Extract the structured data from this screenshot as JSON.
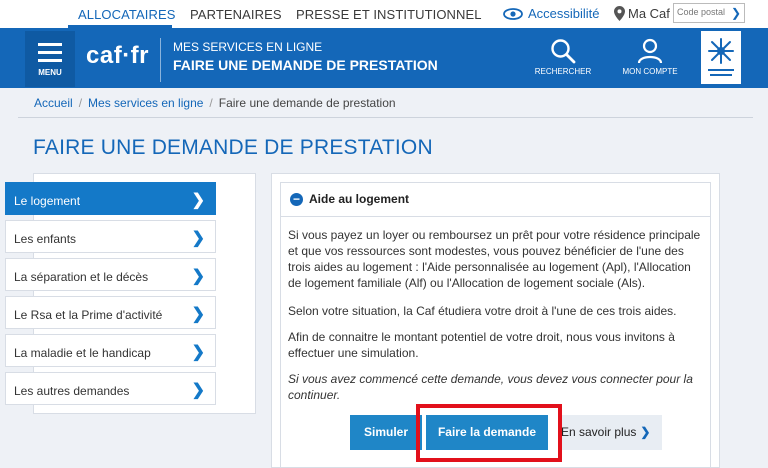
{
  "topnav": {
    "tabs": [
      "ALLOCATAIRES",
      "PARTENAIRES",
      "PRESSE ET INSTITUTIONNEL"
    ],
    "accessibility": "Accessibilité",
    "ma_caf": "Ma Caf",
    "postal_placeholder": "Code postal"
  },
  "header": {
    "menu_label": "MENU",
    "logo": "caf·fr",
    "subtitle": "MES SERVICES EN LIGNE",
    "title": "FAIRE UNE DEMANDE DE PRESTATION",
    "search_label": "RECHERCHER",
    "account_label": "MON COMPTE",
    "brand_color": "#1467b8"
  },
  "breadcrumb": {
    "items": [
      "Accueil",
      "Mes services en ligne",
      "Faire une demande de prestation"
    ],
    "separator": "/"
  },
  "page_title": "FAIRE UNE DEMANDE DE PRESTATION",
  "sidebar": {
    "items": [
      {
        "label": "Le logement"
      },
      {
        "label": "Les enfants"
      },
      {
        "label": "La séparation et le décès"
      },
      {
        "label": "Le Rsa et la Prime d'activité"
      },
      {
        "label": "La maladie et le handicap"
      },
      {
        "label": "Les autres demandes"
      }
    ]
  },
  "section": {
    "title": "Aide au logement",
    "paragraphs": [
      "Si vous payez un loyer ou remboursez un prêt pour votre résidence principale et que vos ressources sont modestes, vous pouvez bénéficier de l'une des trois aides au logement : l'Aide personnalisée au logement (Apl), l'Allocation de logement familiale (Alf) ou l'Allocation de logement sociale (Als).",
      "Selon votre situation, la Caf étudiera votre droit à l'une de ces trois aides.",
      "Afin de connaitre le montant potentiel de votre droit, nous vous invitons à effectuer une simulation."
    ],
    "note": "Si vous avez commencé cette demande, vous devez vous connecter pour la continuer.",
    "buttons": {
      "simulate": "Simuler",
      "apply": "Faire la demande",
      "more": "En savoir plus"
    },
    "highlight_color": "#e2101b"
  }
}
